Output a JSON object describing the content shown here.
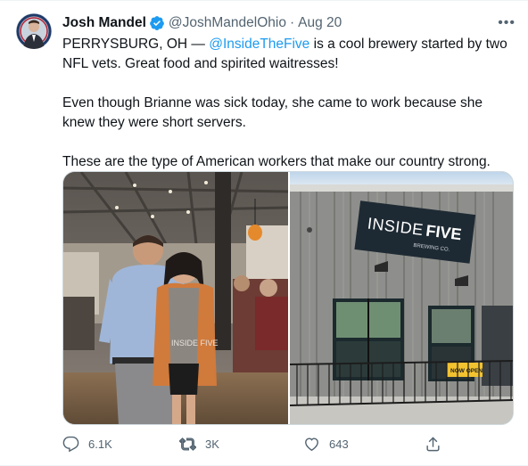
{
  "tweet": {
    "author": {
      "name": "Josh Mandel",
      "handle": "@JoshMandelOhio",
      "separator": "·",
      "date": "Aug 20",
      "verified_icon": "verified-badge-icon"
    },
    "more_label": "•••",
    "text": {
      "line1_prefix": "PERRYSBURG, OH — ",
      "line1_mention": "@InsideTheFive",
      "line1_suffix": " is a cool brewery started by two NFL vets. Great food and spirited waitresses!",
      "para2": "Even though Brianne was sick today, she came to work because she knew they were short servers.",
      "para3": "These are the type of American workers that make our country strong."
    },
    "photos": {
      "left_alt": "Photo of two people standing inside a brewery",
      "right_alt": "Photo of Inside the Five brewery exterior",
      "sign_main": "INSIDE",
      "sign_five": "FIVE",
      "sign_sub": "BREWING CO.",
      "shirt_text": "INSIDE FIVE",
      "small_sign": "NOW OPEN"
    },
    "actions": {
      "replies": "6.1K",
      "retweets": "3K",
      "likes": "643"
    },
    "colors": {
      "accent": "#1d9bf0",
      "text": "#0f1419",
      "secondary": "#536471"
    }
  }
}
